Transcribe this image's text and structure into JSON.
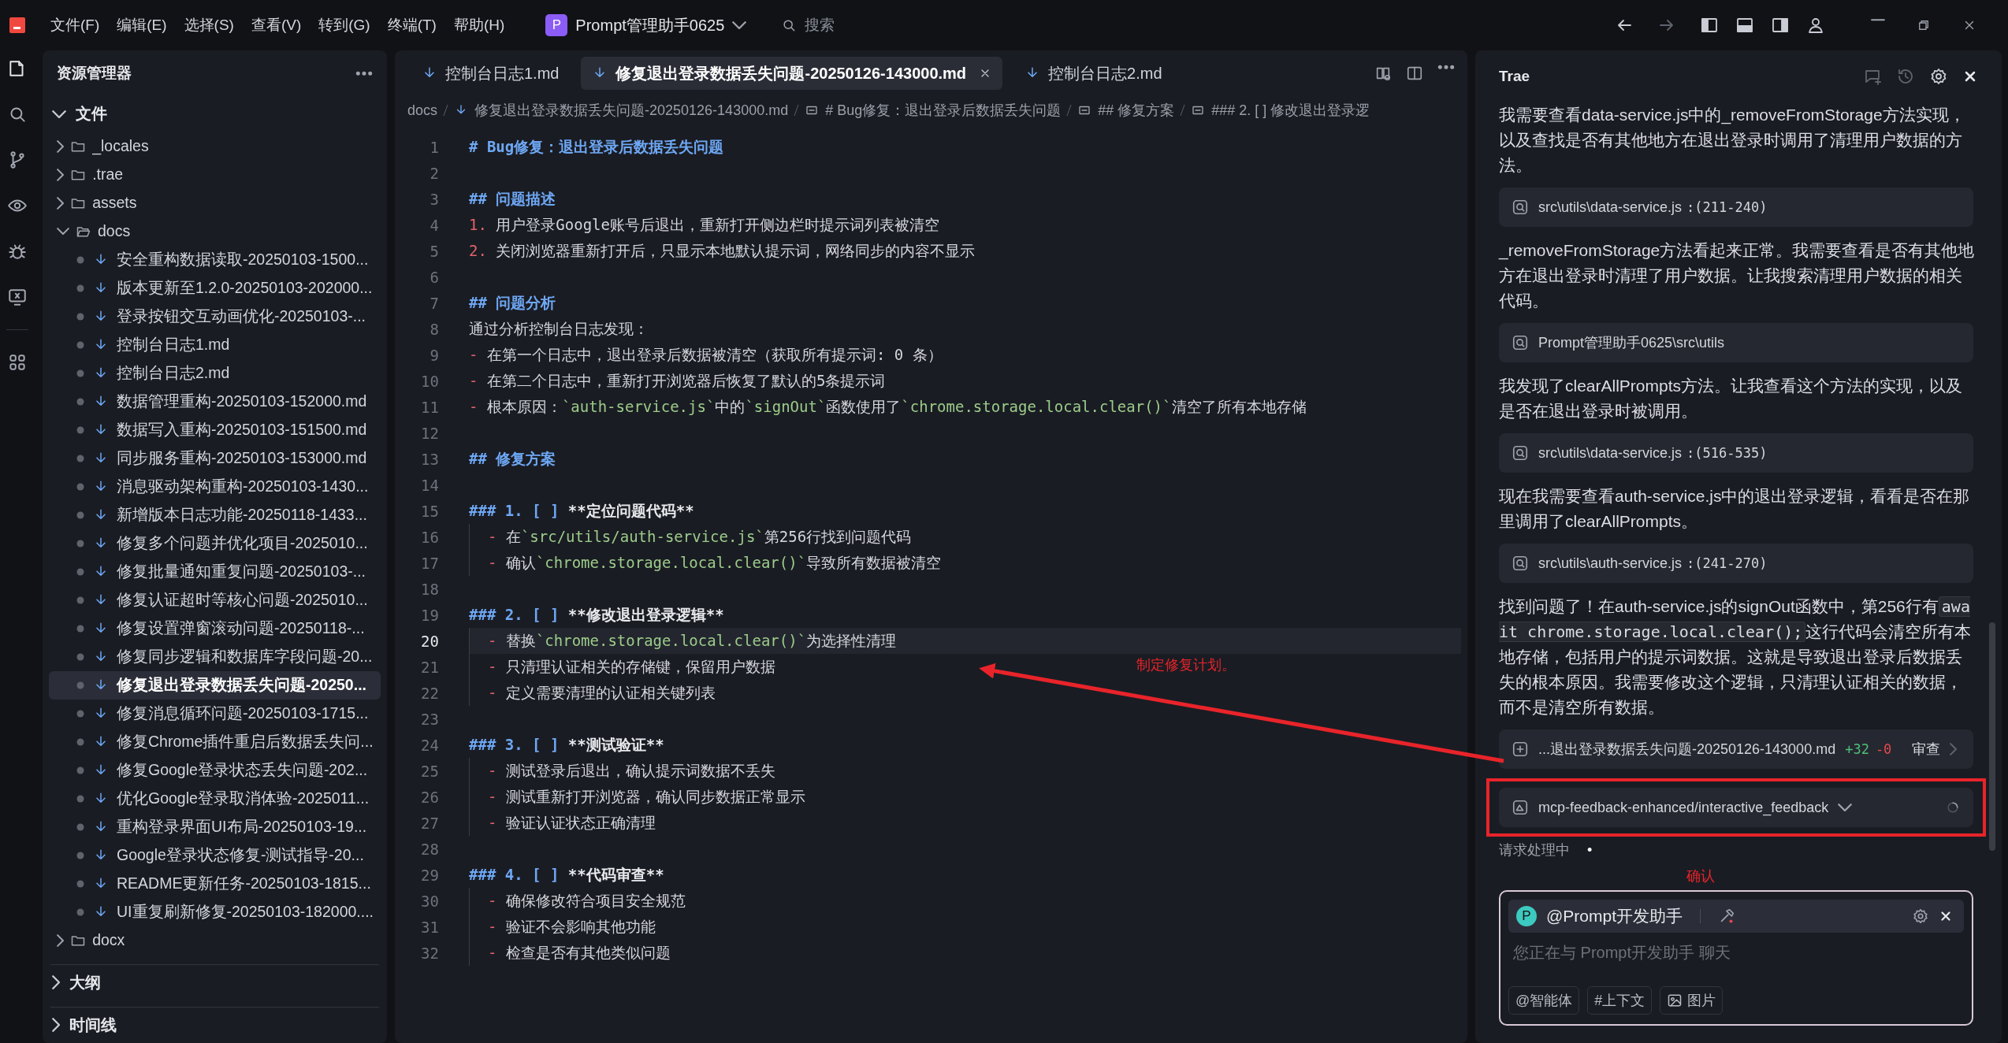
{
  "title_bar": {
    "menus": [
      "文件(F)",
      "编辑(E)",
      "选择(S)",
      "查看(V)",
      "转到(G)",
      "终端(T)",
      "帮助(H)"
    ],
    "project": {
      "badge": "P",
      "name": "Prompt管理助手0625"
    },
    "search": {
      "placeholder": "搜索"
    }
  },
  "explorer": {
    "title": "资源管理器",
    "sections": [
      {
        "label": "文件",
        "expanded": true,
        "tree": [
          {
            "label": "_locales",
            "kind": "folder",
            "expanded": false,
            "selected": false
          },
          {
            "label": ".trae",
            "kind": "folder",
            "expanded": false,
            "selected": false
          },
          {
            "label": "assets",
            "kind": "folder",
            "expanded": false,
            "selected": false
          },
          {
            "label": "docs",
            "kind": "folder",
            "expanded": true,
            "selected": false,
            "children": [
              {
                "label": "安全重构数据读取-20250103-1500...",
                "kind": "file",
                "selected": false
              },
              {
                "label": "版本更新至1.2.0-20250103-202000...",
                "kind": "file",
                "selected": false
              },
              {
                "label": "登录按钮交互动画优化-20250103-...",
                "kind": "file",
                "selected": false
              },
              {
                "label": "控制台日志1.md",
                "kind": "file",
                "selected": false
              },
              {
                "label": "控制台日志2.md",
                "kind": "file",
                "selected": false
              },
              {
                "label": "数据管理重构-20250103-152000.md",
                "kind": "file",
                "selected": false
              },
              {
                "label": "数据写入重构-20250103-151500.md",
                "kind": "file",
                "selected": false
              },
              {
                "label": "同步服务重构-20250103-153000.md",
                "kind": "file",
                "selected": false
              },
              {
                "label": "消息驱动架构重构-20250103-1430...",
                "kind": "file",
                "selected": false
              },
              {
                "label": "新增版本日志功能-20250118-1433...",
                "kind": "file",
                "selected": false
              },
              {
                "label": "修复多个问题并优化项目-2025010...",
                "kind": "file",
                "selected": false
              },
              {
                "label": "修复批量通知重复问题-20250103-...",
                "kind": "file",
                "selected": false
              },
              {
                "label": "修复认证超时等核心问题-2025010...",
                "kind": "file",
                "selected": false
              },
              {
                "label": "修复设置弹窗滚动问题-20250118-...",
                "kind": "file",
                "selected": false
              },
              {
                "label": "修复同步逻辑和数据库字段问题-20...",
                "kind": "file",
                "selected": false
              },
              {
                "label": "修复退出登录数据丢失问题-20250...",
                "kind": "file",
                "selected": true
              },
              {
                "label": "修复消息循环问题-20250103-1715...",
                "kind": "file",
                "selected": false
              },
              {
                "label": "修复Chrome插件重启后数据丢失问...",
                "kind": "file",
                "selected": false
              },
              {
                "label": "修复Google登录状态丢失问题-202...",
                "kind": "file",
                "selected": false
              },
              {
                "label": "优化Google登录取消体验-2025011...",
                "kind": "file",
                "selected": false
              },
              {
                "label": "重构登录界面UI布局-20250103-19...",
                "kind": "file",
                "selected": false
              },
              {
                "label": "Google登录状态修复-测试指导-20...",
                "kind": "file",
                "selected": false
              },
              {
                "label": "README更新任务-20250103-1815...",
                "kind": "file",
                "selected": false
              },
              {
                "label": "UI重复刷新修复-20250103-182000....",
                "kind": "file",
                "selected": false
              }
            ]
          },
          {
            "label": "docx",
            "kind": "folder",
            "expanded": false,
            "selected": false
          }
        ]
      },
      {
        "label": "大纲",
        "expanded": false
      },
      {
        "label": "时间线",
        "expanded": false
      }
    ]
  },
  "editor": {
    "tabs": [
      {
        "label": "控制台日志1.md",
        "selected": false
      },
      {
        "label": "修复退出登录数据丢失问题-20250126-143000.md",
        "selected": true
      },
      {
        "label": "控制台日志2.md",
        "selected": false
      }
    ],
    "breadcrumb": [
      {
        "kind": "folder",
        "text": "docs"
      },
      {
        "kind": "file",
        "text": "修复退出登录数据丢失问题-20250126-143000.md"
      },
      {
        "kind": "symbol",
        "text": "# Bug修复：退出登录后数据丢失问题"
      },
      {
        "kind": "symbol",
        "text": "## 修复方案"
      },
      {
        "kind": "symbol",
        "text": "### 2. [ ] 修改退出登录逻"
      }
    ],
    "lines": [
      {
        "number": "1",
        "current": false,
        "indented": false,
        "segments": [
          {
            "kind": "heading",
            "text": "# Bug修复：退出登录后数据丢失问题"
          }
        ]
      },
      {
        "number": "2",
        "current": false
      },
      {
        "number": "3",
        "current": false,
        "indented": false,
        "segments": [
          {
            "kind": "heading",
            "text": "## 问题描述"
          }
        ]
      },
      {
        "number": "4",
        "current": false,
        "indented": false,
        "segments": [
          {
            "kind": "marker",
            "text": "1."
          },
          {
            "kind": "text",
            "text": " 用户登录Google账号后退出，重新打开侧边栏时提示词列表被清空"
          }
        ]
      },
      {
        "number": "5",
        "current": false,
        "indented": false,
        "segments": [
          {
            "kind": "marker",
            "text": "2."
          },
          {
            "kind": "text",
            "text": " 关闭浏览器重新打开后，只显示本地默认提示词，网络同步的内容不显示"
          }
        ]
      },
      {
        "number": "6",
        "current": false
      },
      {
        "number": "7",
        "current": false,
        "indented": false,
        "segments": [
          {
            "kind": "heading",
            "text": "## 问题分析"
          }
        ]
      },
      {
        "number": "8",
        "current": false,
        "indented": false,
        "segments": [
          {
            "kind": "text",
            "text": "通过分析控制台日志发现："
          }
        ]
      },
      {
        "number": "9",
        "current": false,
        "indented": false,
        "segments": [
          {
            "kind": "marker",
            "text": "-"
          },
          {
            "kind": "text",
            "text": " 在第一个日志中，退出登录后数据被清空（获取所有提示词: 0 条）"
          }
        ]
      },
      {
        "number": "10",
        "current": false,
        "indented": false,
        "segments": [
          {
            "kind": "marker",
            "text": "-"
          },
          {
            "kind": "text",
            "text": " 在第二个日志中，重新打开浏览器后恢复了默认的5条提示词"
          }
        ]
      },
      {
        "number": "11",
        "current": false,
        "indented": false,
        "segments": [
          {
            "kind": "marker",
            "text": "-"
          },
          {
            "kind": "text",
            "text": " 根本原因："
          },
          {
            "kind": "code",
            "text": "`auth-service.js`"
          },
          {
            "kind": "text",
            "text": "中的"
          },
          {
            "kind": "code",
            "text": "`signOut`"
          },
          {
            "kind": "text",
            "text": "函数使用了"
          },
          {
            "kind": "code",
            "text": "`chrome.storage.local.clear()`"
          },
          {
            "kind": "text",
            "text": "清空了所有本地存储"
          }
        ]
      },
      {
        "number": "12",
        "current": false
      },
      {
        "number": "13",
        "current": false,
        "indented": false,
        "segments": [
          {
            "kind": "heading",
            "text": "## 修复方案"
          }
        ]
      },
      {
        "number": "14",
        "current": false
      },
      {
        "number": "15",
        "current": false,
        "indented": false,
        "segments": [
          {
            "kind": "heading",
            "text": "### 1. [ ]"
          },
          {
            "kind": "bold",
            "text": " **定位问题代码**"
          }
        ]
      },
      {
        "number": "16",
        "current": false,
        "indented": true,
        "segments": [
          {
            "kind": "marker",
            "text": "-"
          },
          {
            "kind": "text",
            "text": " 在"
          },
          {
            "kind": "code",
            "text": "`src/utils/auth-service.js`"
          },
          {
            "kind": "text",
            "text": "第256行找到问题代码"
          }
        ]
      },
      {
        "number": "17",
        "current": false,
        "indented": true,
        "segments": [
          {
            "kind": "marker",
            "text": "-"
          },
          {
            "kind": "text",
            "text": " 确认"
          },
          {
            "kind": "code",
            "text": "`chrome.storage.local.clear()`"
          },
          {
            "kind": "text",
            "text": "导致所有数据被清空"
          }
        ]
      },
      {
        "number": "18",
        "current": false
      },
      {
        "number": "19",
        "current": false,
        "indented": false,
        "segments": [
          {
            "kind": "heading",
            "text": "### 2. [ ]"
          },
          {
            "kind": "bold",
            "text": " **修改退出登录逻辑**"
          }
        ]
      },
      {
        "number": "20",
        "current": true,
        "indented": true,
        "segments": [
          {
            "kind": "marker",
            "text": "-"
          },
          {
            "kind": "text",
            "text": " 替换"
          },
          {
            "kind": "code",
            "text": "`chrome.storage.local.clear()`"
          },
          {
            "kind": "text",
            "text": "为选择性清理"
          }
        ]
      },
      {
        "number": "21",
        "current": false,
        "indented": true,
        "segments": [
          {
            "kind": "marker",
            "text": "-"
          },
          {
            "kind": "text",
            "text": " 只清理认证相关的存储键，保留用户数据"
          }
        ]
      },
      {
        "number": "22",
        "current": false,
        "indented": true,
        "segments": [
          {
            "kind": "marker",
            "text": "-"
          },
          {
            "kind": "text",
            "text": " 定义需要清理的认证相关键列表"
          }
        ]
      },
      {
        "number": "23",
        "current": false
      },
      {
        "number": "24",
        "current": false,
        "indented": false,
        "segments": [
          {
            "kind": "heading",
            "text": "### 3. [ ]"
          },
          {
            "kind": "bold",
            "text": " **测试验证**"
          }
        ]
      },
      {
        "number": "25",
        "current": false,
        "indented": true,
        "segments": [
          {
            "kind": "marker",
            "text": "-"
          },
          {
            "kind": "text",
            "text": " 测试登录后退出，确认提示词数据不丢失"
          }
        ]
      },
      {
        "number": "26",
        "current": false,
        "indented": true,
        "segments": [
          {
            "kind": "marker",
            "text": "-"
          },
          {
            "kind": "text",
            "text": " 测试重新打开浏览器，确认同步数据正常显示"
          }
        ]
      },
      {
        "number": "27",
        "current": false,
        "indented": true,
        "segments": [
          {
            "kind": "marker",
            "text": "-"
          },
          {
            "kind": "text",
            "text": " 验证认证状态正确清理"
          }
        ]
      },
      {
        "number": "28",
        "current": false
      },
      {
        "number": "29",
        "current": false,
        "indented": false,
        "segments": [
          {
            "kind": "heading",
            "text": "### 4. [ ]"
          },
          {
            "kind": "bold",
            "text": " **代码审查**"
          }
        ]
      },
      {
        "number": "30",
        "current": false,
        "indented": true,
        "segments": [
          {
            "kind": "marker",
            "text": "-"
          },
          {
            "kind": "text",
            "text": " 确保修改符合项目安全规范"
          }
        ]
      },
      {
        "number": "31",
        "current": false,
        "indented": true,
        "segments": [
          {
            "kind": "marker",
            "text": "-"
          },
          {
            "kind": "text",
            "text": " 验证不会影响其他功能"
          }
        ]
      },
      {
        "number": "32",
        "current": false,
        "indented": true,
        "segments": [
          {
            "kind": "marker",
            "text": "-"
          },
          {
            "kind": "text",
            "text": " 检查是否有其他类似问题"
          }
        ]
      }
    ]
  },
  "chat": {
    "title": "Trae",
    "messages": [
      {
        "kind": "text",
        "parts": [
          {
            "kind": "text",
            "text": "我需要查看data-service.js中的_removeFromStorage方法实现，以及查找是否有其他地方在退出登录时调用了清理用户数据的方法。"
          }
        ]
      },
      {
        "kind": "ref",
        "path": "src\\utils\\data-service.js",
        "range": ":(211-240)"
      },
      {
        "kind": "text",
        "parts": [
          {
            "kind": "text",
            "text": "_removeFromStorage方法看起来正常。我需要查看是否有其他地方在退出登录时清理了用户数据。让我搜索清理用户数据的相关代码。"
          }
        ]
      },
      {
        "kind": "ref",
        "path": "Prompt管理助手0625\\src\\utils"
      },
      {
        "kind": "text",
        "parts": [
          {
            "kind": "text",
            "text": "我发现了clearAllPrompts方法。让我查看这个方法的实现，以及是否在退出登录时被调用。"
          }
        ]
      },
      {
        "kind": "ref",
        "path": "src\\utils\\data-service.js",
        "range": ":(516-535)"
      },
      {
        "kind": "text",
        "parts": [
          {
            "kind": "text",
            "text": "现在我需要查看auth-service.js中的退出登录逻辑，看看是否在那里调用了clearAllPrompts。"
          }
        ]
      },
      {
        "kind": "ref",
        "path": "src\\utils\\auth-service.js",
        "range": ":(241-270)"
      },
      {
        "kind": "text",
        "parts": [
          {
            "kind": "text",
            "text": "找到问题了！在auth-service.js的signOut函数中，第256行有"
          },
          {
            "kind": "code",
            "text": "await chrome.storage.local.clear();"
          },
          {
            "kind": "text",
            "text": "这行代码会清空所有本地存储，包括用户的提示词数据。这就是导致退出登录后数据丢失的根本原因。我需要修改这个逻辑，只清理认证相关的数据，而不是清空所有数据。"
          }
        ]
      },
      {
        "kind": "diff",
        "file": "...退出登录数据丢失问题-20250126-143000.md",
        "added": "+32",
        "removed": "-0",
        "action": "审查"
      }
    ],
    "tool_call": {
      "name": "mcp-feedback-enhanced/interactive_feedback",
      "running": true
    },
    "status": {
      "text": "请求处理中",
      "dot": "•"
    },
    "input": {
      "agent_badge": "P",
      "agent": "@Prompt开发助手",
      "placeholder": "您正在与 Prompt开发助手 聊天",
      "buttons": [
        {
          "text": "@智能体",
          "kind": "plain"
        },
        {
          "text": "#上下文",
          "kind": "plain"
        },
        {
          "text": "图片",
          "kind": "image"
        }
      ]
    }
  },
  "annotations": [
    {
      "kind": "arrow"
    },
    {
      "kind": "note",
      "text": "制定修复计划。"
    },
    {
      "kind": "box"
    },
    {
      "kind": "note",
      "text": "确认"
    }
  ]
}
